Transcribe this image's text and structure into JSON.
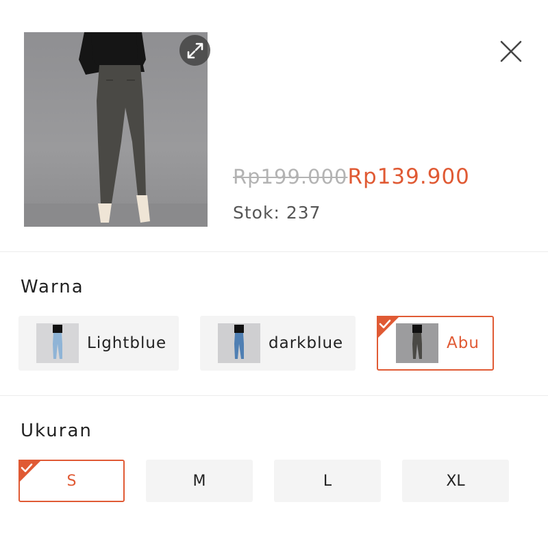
{
  "product": {
    "old_price": "Rp199.000",
    "new_price": "Rp139.900",
    "stock": "Stok: 237"
  },
  "color_section": {
    "title": "Warna",
    "options": [
      {
        "label": "Lightblue",
        "selected": false
      },
      {
        "label": "darkblue",
        "selected": false
      },
      {
        "label": "Abu",
        "selected": true
      }
    ]
  },
  "size_section": {
    "title": "Ukuran",
    "options": [
      {
        "label": "S",
        "selected": true
      },
      {
        "label": "M",
        "selected": false
      },
      {
        "label": "L",
        "selected": false
      },
      {
        "label": "XL",
        "selected": false
      }
    ]
  },
  "icons": {
    "expand": "expand-icon",
    "close": "close-icon",
    "check": "check-icon"
  },
  "colors": {
    "accent": "#e05a34",
    "option_bg": "#f4f4f4",
    "strike_price": "#b3b3b3"
  }
}
